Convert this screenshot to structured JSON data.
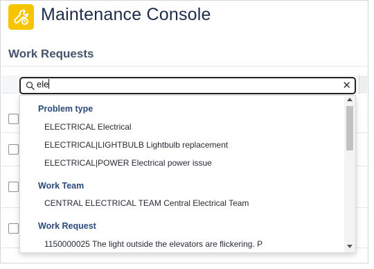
{
  "app": {
    "title": "Maintenance Console",
    "icon": "maintenance-tools-icon",
    "accent_color": "#f6c500"
  },
  "page": {
    "section_title": "Work Requests"
  },
  "search": {
    "value": "ele",
    "clear_icon": "close-icon",
    "search_icon": "search-icon"
  },
  "dropdown": {
    "groups": [
      {
        "heading": "Problem type",
        "options": [
          "ELECTRICAL Electrical",
          "ELECTRICAL|LIGHTBULB Lightbulb replacement",
          "ELECTRICAL|POWER Electrical power issue"
        ]
      },
      {
        "heading": "Work Team",
        "options": [
          "CENTRAL ELECTRICAL TEAM Central Electrical Team"
        ]
      },
      {
        "heading": "Work Request",
        "options": [
          "1150000025 The light outside the elevators are flickering. P"
        ]
      }
    ]
  }
}
